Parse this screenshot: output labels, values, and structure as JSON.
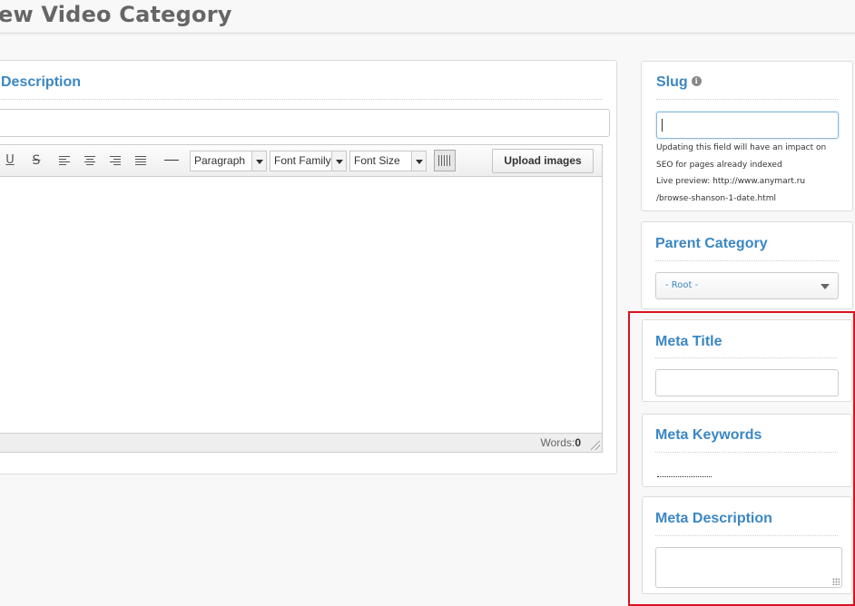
{
  "page": {
    "title": "ew Video Category"
  },
  "main": {
    "section_heading": "Description",
    "name_input_value": "",
    "editor": {
      "toolbar": {
        "underline_label": "U",
        "strike_label": "S",
        "format_select": "Paragraph",
        "font_family_select": "Font Family",
        "font_size_select": "Font Size",
        "upload_label": "Upload images"
      },
      "words_label": "Words:",
      "words_count": "0"
    }
  },
  "sidebar": {
    "slug": {
      "heading": "Slug",
      "input_value": "",
      "help_line1": "Updating this field will have an impact on",
      "help_line2": "SEO for pages already indexed",
      "help_line3": "Live preview: http://www.anymart.ru",
      "help_line4": "/browse-shanson-1-date.html"
    },
    "parent_category": {
      "heading": "Parent Category",
      "selected": "- Root -"
    },
    "meta_title": {
      "heading": "Meta Title",
      "value": ""
    },
    "meta_keywords": {
      "heading": "Meta Keywords"
    },
    "meta_description": {
      "heading": "Meta Description",
      "value": ""
    }
  },
  "colors": {
    "heading_blue": "#3b87c4",
    "highlight_red": "#d9121f"
  },
  "icons": [
    "info-icon",
    "underline-icon",
    "strikethrough-icon",
    "align-left-icon",
    "align-center-icon",
    "align-right-icon",
    "align-justify-icon",
    "horizontal-rule-icon",
    "dropdown-arrow-icon",
    "visual-aid-grid-icon",
    "resize-grip-icon",
    "chevron-down-icon"
  ]
}
